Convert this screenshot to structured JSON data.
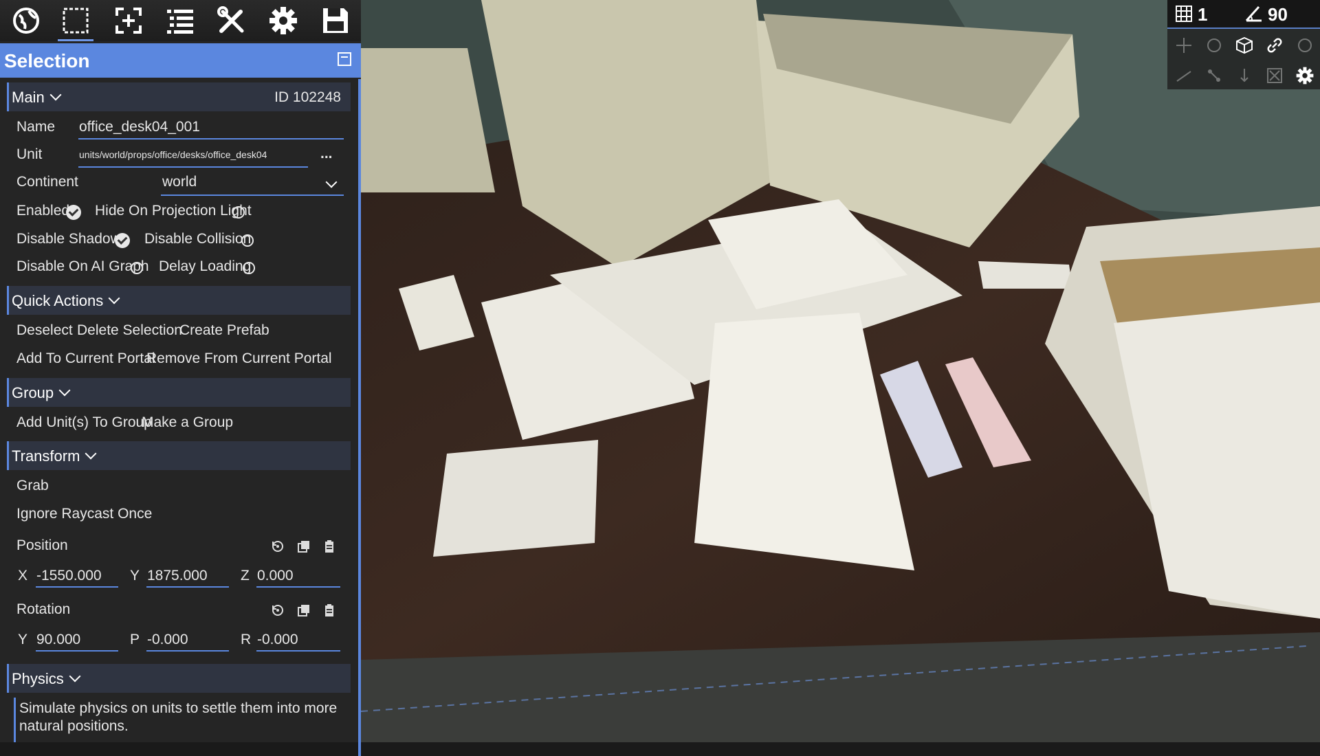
{
  "toolbar": {
    "tools": [
      "globe-icon",
      "selection-box-icon",
      "add-frame-icon",
      "list-icon",
      "tools-icon",
      "settings-icon",
      "save-icon"
    ],
    "active_tool": "selection-box-icon"
  },
  "hud": {
    "grid_value": "1",
    "angle_value": "90"
  },
  "panel": {
    "title": "Selection",
    "main": {
      "label": "Main",
      "id_text": "ID 102248",
      "name_label": "Name",
      "name_value": "office_desk04_001",
      "unit_label": "Unit",
      "unit_value": "units/world/props/office/desks/office_desk04",
      "unit_more": "...",
      "continent_label": "Continent",
      "continent_value": "world",
      "enabled_label": "Enabled",
      "enabled": true,
      "hide_projection_label": "Hide On Projection Light",
      "hide_projection": false,
      "disable_shadows_label": "Disable Shadows",
      "disable_shadows": true,
      "disable_collision_label": "Disable Collision",
      "disable_collision": false,
      "disable_ai_label": "Disable On AI Graph",
      "disable_ai": false,
      "delay_loading_label": "Delay Loading",
      "delay_loading": false
    },
    "quick_actions": {
      "label": "Quick Actions",
      "deselect": "Deselect",
      "delete_selection": "Delete Selection",
      "create_prefab": "Create Prefab",
      "add_portal": "Add To Current Portal",
      "remove_portal": "Remove From Current Portal"
    },
    "group": {
      "label": "Group",
      "add_units": "Add Unit(s) To Group",
      "make_group": "Make a Group"
    },
    "transform": {
      "label": "Transform",
      "grab": "Grab",
      "ignore_raycast": "Ignore Raycast Once",
      "position_label": "Position",
      "pos_x_label": "X",
      "pos_x": "-1550.000",
      "pos_y_label": "Y",
      "pos_y": "1875.000",
      "pos_z_label": "Z",
      "pos_z": "0.000",
      "rotation_label": "Rotation",
      "rot_y_label": "Y",
      "rot_y": "90.000",
      "rot_p_label": "P",
      "rot_p": "-0.000",
      "rot_r_label": "R",
      "rot_r": "-0.000"
    },
    "physics": {
      "label": "Physics",
      "description": "Simulate physics on units to settle them into more natural positions."
    }
  },
  "colors": {
    "accent": "#5b87df",
    "panel_bg": "#242424",
    "desk": "#3a2a22"
  }
}
